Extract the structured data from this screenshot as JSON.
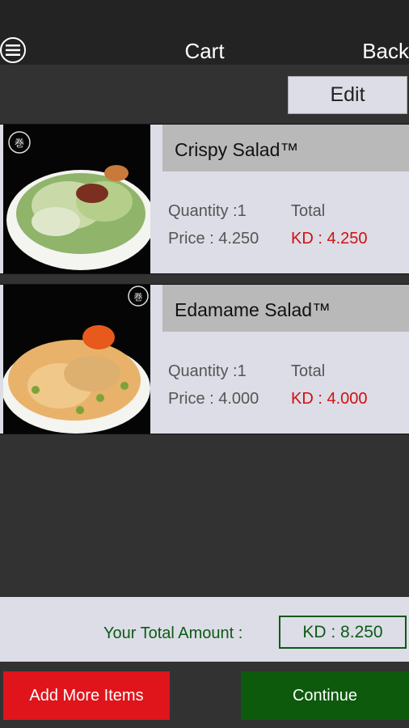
{
  "header": {
    "title": "Cart",
    "back_label": "Back",
    "menu_icon": "menu-icon"
  },
  "toolbar": {
    "edit_label": "Edit"
  },
  "items": [
    {
      "name": "Crispy Salad™",
      "quantity": "Quantity :1",
      "total_label": "Total",
      "price": "Price : 4.250",
      "total_value": "KD : 4.250"
    },
    {
      "name": "Edamame Salad™",
      "quantity": "Quantity :1",
      "total_label": "Total",
      "price": "Price : 4.000",
      "total_value": "KD : 4.000"
    }
  ],
  "summary": {
    "label": "Your Total Amount :",
    "value": "KD : 8.250"
  },
  "actions": {
    "add_more": "Add More Items",
    "continue": "Continue"
  },
  "colors": {
    "accent_red": "#e0141b",
    "accent_green": "#0d5a0d",
    "price_red": "#d01010"
  }
}
